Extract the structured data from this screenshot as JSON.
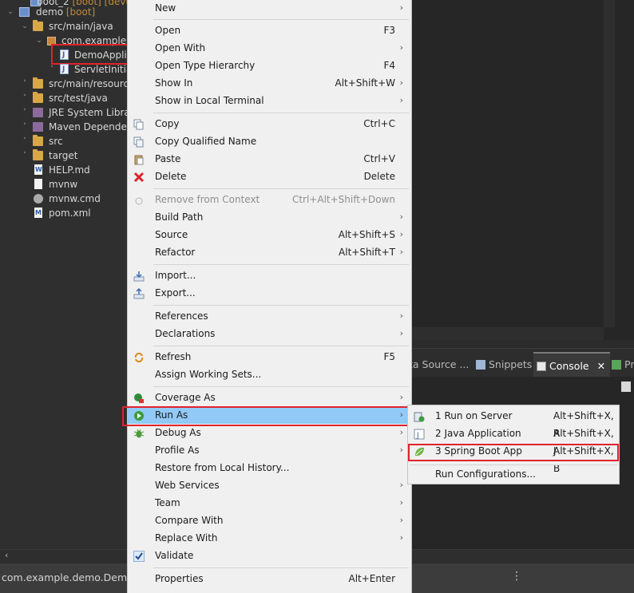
{
  "explorer": {
    "rows": [
      {
        "label": "boot_2",
        "decor": "[boot] [devtools]"
      },
      {
        "label": "demo",
        "decor": "[boot]"
      },
      {
        "label": "src/main/java"
      },
      {
        "label": "com.example.demo"
      },
      {
        "label": "DemoApplication.java"
      },
      {
        "label": "ServletInitializer.java"
      },
      {
        "label": "src/main/resources"
      },
      {
        "label": "src/test/java"
      },
      {
        "label": "JRE System Library"
      },
      {
        "label": "Maven Dependencies"
      },
      {
        "label": "src"
      },
      {
        "label": "target"
      },
      {
        "label": "HELP.md"
      },
      {
        "label": "mvnw"
      },
      {
        "label": "mvnw.cmd"
      },
      {
        "label": "pom.xml"
      }
    ]
  },
  "views": {
    "tabs": [
      {
        "label": "Data Source Explorer",
        "shown": "ta Source ..."
      },
      {
        "label": "Snippets"
      },
      {
        "label": "Console"
      },
      {
        "label": "Pr"
      }
    ],
    "console_close": "✕"
  },
  "status": {
    "text": "com.example.demo.DemoApplication.java - demo/src/main/java",
    "shown": "com.example.demo.DemoApp",
    "grip": "⋮"
  },
  "menu": {
    "items": [
      {
        "label": "New",
        "submenu": true
      },
      {
        "label": "Open",
        "shortcut": "F3"
      },
      {
        "label": "Open With",
        "submenu": true
      },
      {
        "label": "Open Type Hierarchy",
        "shortcut": "F4"
      },
      {
        "label": "Show In",
        "shortcut": "Alt+Shift+W",
        "submenu": true
      },
      {
        "label": "Show in Local Terminal",
        "submenu": true
      },
      {
        "label": "Copy",
        "shortcut": "Ctrl+C",
        "icon": "copy-icon"
      },
      {
        "label": "Copy Qualified Name",
        "icon": "copy-qualified-icon"
      },
      {
        "label": "Paste",
        "shortcut": "Ctrl+V",
        "icon": "paste-icon"
      },
      {
        "label": "Delete",
        "shortcut": "Delete",
        "icon": "delete-icon"
      },
      {
        "label": "Remove from Context",
        "shortcut": "Ctrl+Alt+Shift+Down",
        "disabled": true,
        "icon": "remove-context-icon"
      },
      {
        "label": "Build Path",
        "submenu": true
      },
      {
        "label": "Source",
        "shortcut": "Alt+Shift+S",
        "submenu": true
      },
      {
        "label": "Refactor",
        "shortcut": "Alt+Shift+T",
        "submenu": true
      },
      {
        "label": "Import...",
        "icon": "import-icon"
      },
      {
        "label": "Export...",
        "icon": "export-icon"
      },
      {
        "label": "References",
        "submenu": true
      },
      {
        "label": "Declarations",
        "submenu": true
      },
      {
        "label": "Refresh",
        "shortcut": "F5",
        "icon": "refresh-icon"
      },
      {
        "label": "Assign Working Sets..."
      },
      {
        "label": "Coverage As",
        "submenu": true,
        "icon": "coverage-icon"
      },
      {
        "label": "Run As",
        "submenu": true,
        "icon": "run-icon",
        "highlighted": true
      },
      {
        "label": "Debug As",
        "submenu": true,
        "icon": "debug-icon"
      },
      {
        "label": "Profile As",
        "submenu": true
      },
      {
        "label": "Restore from Local History..."
      },
      {
        "label": "Web Services",
        "submenu": true
      },
      {
        "label": "Team",
        "submenu": true
      },
      {
        "label": "Compare With",
        "submenu": true
      },
      {
        "label": "Replace With",
        "submenu": true
      },
      {
        "label": "Validate",
        "checked": true,
        "icon": "check-icon"
      },
      {
        "label": "Properties",
        "shortcut": "Alt+Enter"
      }
    ],
    "arrow": "›"
  },
  "submenu": {
    "items": [
      {
        "label": "1 Run on Server",
        "shortcut": "Alt+Shift+X, R",
        "icon": "server-icon"
      },
      {
        "label": "2 Java Application",
        "shortcut": "Alt+Shift+X, J",
        "icon": "java-app-icon"
      },
      {
        "label": "3 Spring Boot App",
        "shortcut": "Alt+Shift+X, B",
        "icon": "spring-boot-icon"
      },
      {
        "label": "Run Configurations..."
      }
    ]
  },
  "colors": {
    "menu_bg": "#f0f0f0",
    "highlight": "#91c9f7",
    "annotation_red": "#e0232b",
    "ide_dark": "#2b2b2b"
  }
}
